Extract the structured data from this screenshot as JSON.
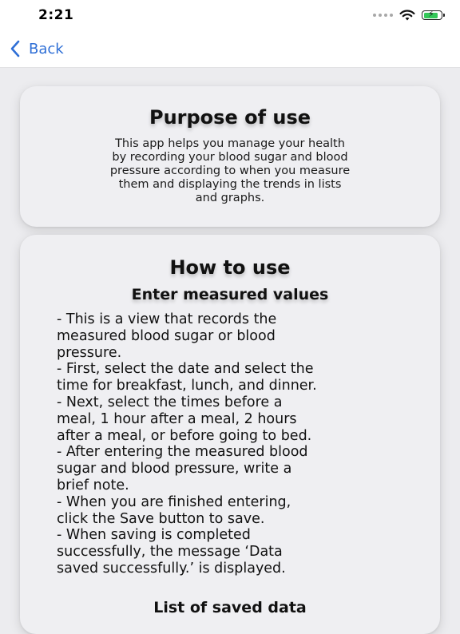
{
  "status_bar": {
    "time": "2:21",
    "icons": [
      "signal-dots-icon",
      "wifi-icon",
      "battery-charging-icon"
    ],
    "battery_level": 0.85,
    "battery_color": "#34c759"
  },
  "nav": {
    "back_label": "Back",
    "back_icon": "chevron-left-icon",
    "accent": "#2f6fd6"
  },
  "purpose": {
    "title": "Purpose of use",
    "lines": [
      "This app helps you manage your health",
      "by recording your blood sugar and blood",
      "pressure according to when you measure",
      "them and displaying the trends in lists",
      "and graphs."
    ]
  },
  "how_to": {
    "title": "How to use",
    "subtitle": "Enter measured values",
    "lines": [
      "- This is a view that records the",
      "measured blood sugar or blood",
      "pressure.",
      "- First, select the date and select the",
      "time for breakfast, lunch, and dinner.",
      "- Next, select the times before a",
      "meal, 1 hour after a meal, 2 hours",
      "after a meal, or before going to bed.",
      "- After entering the measured blood",
      "sugar and blood pressure, write a",
      "brief note.",
      "- When you are finished entering,",
      "click the Save button to save.",
      "- When saving is completed",
      "successfully, the message ‘Data",
      "saved successfully.’ is displayed."
    ],
    "next_heading": "List of saved data"
  }
}
